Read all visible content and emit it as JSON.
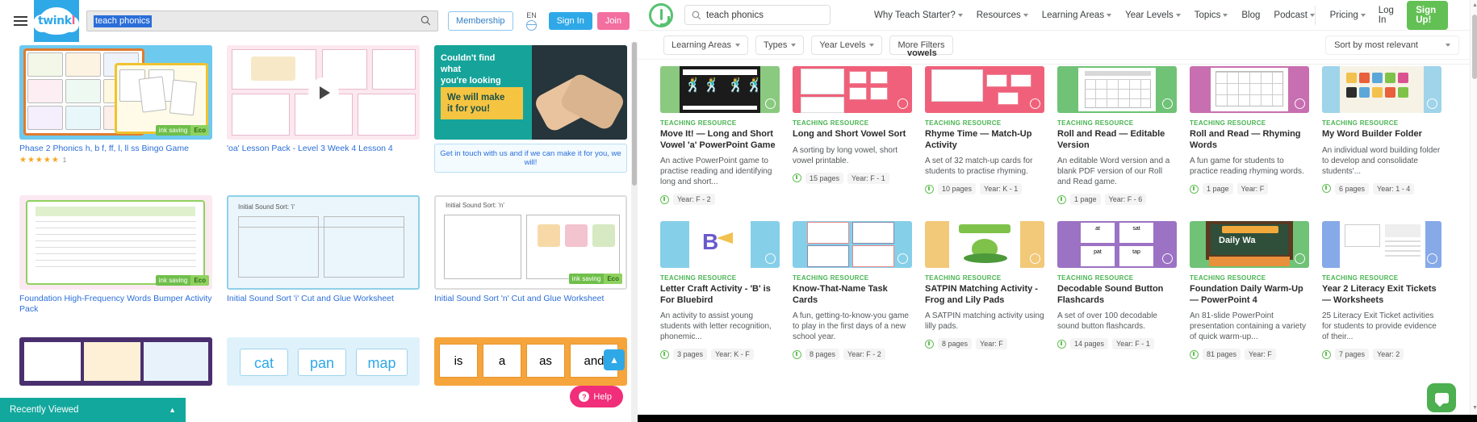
{
  "left_panel": {
    "brand": "twinkl",
    "brand_main": "twink",
    "brand_accent": "l",
    "menu_icon": "hamburger-icon",
    "search": {
      "value": "teach phonics",
      "placeholder": "Search",
      "icon": "search-icon"
    },
    "membership_label": "Membership",
    "language": "EN",
    "sign_in_label": "Sign In",
    "join_label": "Join",
    "eco_badge": {
      "text": "ink saving",
      "label": "Eco"
    },
    "cards": [
      {
        "title": "Phase 2 Phonics h, b f, ff, l, ll ss Bingo Game",
        "rating": "★★★★★",
        "rating_count": "1",
        "has_rating": true,
        "thumb": "phonics-bingo-cards"
      },
      {
        "title": "'oa' Lesson Pack - Level 3 Week 4 Lesson 4",
        "thumb": "oa-lesson-pack-video",
        "has_play": true
      },
      {
        "promo": true,
        "promo_line1": "Couldn't find what",
        "promo_line2": "you're looking for?",
        "promo_highlight1": "We will make",
        "promo_highlight2": "it for you!",
        "promo_cta": "Get in touch with us and if we can make it for you, we will!"
      },
      {
        "title": "Foundation High-Frequency Words Bumper Activity Pack",
        "thumb": "high-frequency-words-pack"
      },
      {
        "title": "Initial Sound Sort 'i' Cut and Glue Worksheet",
        "thumb": "initial-sound-sort-i"
      },
      {
        "title": "Initial Sound Sort 'n' Cut and Glue Worksheet",
        "thumb": "initial-sound-sort-n"
      },
      {
        "thumb": "bright-star-phonics"
      },
      {
        "thumb": "cat-pan-map-words"
      },
      {
        "thumb": "is-a-as-and-the-cards"
      }
    ],
    "recently_viewed": "Recently Viewed",
    "help_label": "Help",
    "back_to_top_icon": "chevron-up-icon"
  },
  "right_panel": {
    "logo_icon": "teach-starter-logo",
    "search": {
      "value": "teach phonics",
      "placeholder": "Search",
      "icon": "search-icon"
    },
    "nav": [
      {
        "label": "Why Teach Starter?",
        "has_caret": true
      },
      {
        "label": "Resources",
        "has_caret": true
      },
      {
        "label": "Learning Areas",
        "has_caret": true
      },
      {
        "label": "Year Levels",
        "has_caret": true
      },
      {
        "label": "Topics",
        "has_caret": true
      },
      {
        "label": "Blog",
        "has_caret": false
      },
      {
        "label": "Podcast",
        "has_caret": true
      }
    ],
    "account": [
      {
        "label": "Pricing",
        "has_caret": true
      },
      {
        "label": "Log In",
        "has_caret": false
      }
    ],
    "signup_label": "Sign Up!",
    "filters": [
      {
        "label": "Learning Areas",
        "has_caret": true
      },
      {
        "label": "Types",
        "has_caret": true
      },
      {
        "label": "Year Levels",
        "has_caret": true
      },
      {
        "label": "More Filters",
        "has_caret": false
      }
    ],
    "sort_label": "Sort by most relevant",
    "breadcrumb_partial": "vowels",
    "results": [
      {
        "kind": "TEACHING RESOURCE",
        "title": "Move It! — Long and Short Vowel 'a' PowerPoint Game",
        "desc": "An active PowerPoint game to practise reading and identifying long and short...",
        "pages": "",
        "year": "Year: F - 2",
        "thumb": "dancing-figures-black",
        "thumb_bg": "#7cc576"
      },
      {
        "kind": "TEACHING RESOURCE",
        "title": "Long and Short Vowel Sort",
        "desc": "A sorting by long vowel, short vowel printable.",
        "pages": "15 pages",
        "year": "Year: F - 1",
        "thumb": "vowel-sort-cards",
        "thumb_bg": "#f0607a"
      },
      {
        "kind": "TEACHING RESOURCE",
        "title": "Rhyme Time — Match-Up Activity",
        "desc": "A set of 32 match-up cards for students to practise rhyming.",
        "pages": "10 pages",
        "year": "Year: K - 1",
        "thumb": "match-up-cards",
        "thumb_bg": "#f0607a"
      },
      {
        "kind": "TEACHING RESOURCE",
        "title": "Roll and Read — Editable Version",
        "desc": "An editable Word version and a blank PDF version of our Roll and Read game.",
        "pages": "1 page",
        "year": "Year: F - 6",
        "thumb": "roll-and-read-grid",
        "thumb_bg": "#6fc276"
      },
      {
        "kind": "TEACHING RESOURCE",
        "title": "Roll and Read — Rhyming Words",
        "desc": "A fun game for students to practice reading rhyming words.",
        "pages": "1 page",
        "year": "Year: F",
        "thumb": "roll-and-read-rhyming-grid",
        "thumb_bg": "#c濃"
      },
      {
        "kind": "TEACHING RESOURCE",
        "title": "My Word Builder Folder",
        "desc": "An individual word building folder to develop and consolidate students'...",
        "pages": "6 pages",
        "year": "Year: 1 - 4",
        "thumb": "word-builder-tiles",
        "thumb_bg": "#c76fb0"
      },
      {
        "kind": "TEACHING RESOURCE",
        "title": "Letter Craft Activity - 'B' is For Bluebird",
        "desc": "An activity to assist young students with letter recognition, phonemic...",
        "pages": "3 pages",
        "year": "Year: K - F",
        "thumb": "bluebird-letter-b",
        "thumb_bg": "#86cfe8"
      },
      {
        "kind": "TEACHING RESOURCE",
        "title": "Know-That-Name Task Cards",
        "desc": "A fun, getting-to-know-you game to play in the first days of a new school year.",
        "pages": "8 pages",
        "year": "Year: F - 2",
        "thumb": "task-cards-grid",
        "thumb_bg": "#86cfe8"
      },
      {
        "kind": "TEACHING RESOURCE",
        "title": "SATPIN Matching Activity - Frog and Lily Pads",
        "desc": "A SATPIN matching activity using lilly pads.",
        "pages": "8 pages",
        "year": "Year: F",
        "thumb": "frog-lily-pad",
        "thumb_bg": "#f2c879"
      },
      {
        "kind": "TEACHING RESOURCE",
        "title": "Decodable Sound Button Flashcards",
        "desc": "A set of over 100 decodable sound button flashcards.",
        "pages": "14 pages",
        "year": "Year: F - 1",
        "thumb": "sound-button-flashcards",
        "thumb_bg": "#9b72c4"
      },
      {
        "kind": "TEACHING RESOURCE",
        "title": "Foundation Daily Warm-Up — PowerPoint 4",
        "desc": "An 81-slide PowerPoint presentation containing a variety of quick warm-up...",
        "pages": "81 pages",
        "year": "Year: F",
        "thumb": "daily-warm-up-chalkboard",
        "thumb_bg": "#6fc276"
      },
      {
        "kind": "TEACHING RESOURCE",
        "title": "Year 2 Literacy Exit Tickets — Worksheets",
        "desc": "25 Literacy Exit Ticket activities for students to provide evidence of their...",
        "pages": "7 pages",
        "year": "Year: 2",
        "thumb": "exit-tickets-worksheets",
        "thumb_bg": "#86a9e8"
      }
    ],
    "chat_icon": "chat-bubble-icon"
  }
}
